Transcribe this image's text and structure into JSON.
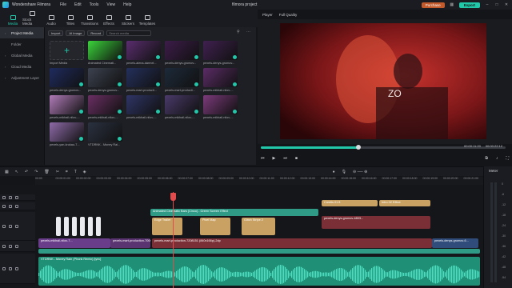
{
  "app": {
    "name": "Wondershare Filmora",
    "project_name": "filmora project"
  },
  "menu": [
    "File",
    "Edit",
    "Tools",
    "View",
    "Help"
  ],
  "header_buttons": {
    "purchase": "Purchase",
    "export": "Export"
  },
  "toolbar": [
    {
      "label": "Media",
      "active": true
    },
    {
      "label": "Stock Media",
      "active": false
    },
    {
      "label": "Audio",
      "active": false
    },
    {
      "label": "Titles",
      "active": false
    },
    {
      "label": "Transitions",
      "active": false
    },
    {
      "label": "Effects",
      "active": false
    },
    {
      "label": "Stickers",
      "active": false
    },
    {
      "label": "Templates",
      "active": false
    }
  ],
  "sidebar": [
    {
      "label": "Project Media",
      "active": true
    },
    {
      "label": "Folder",
      "active": false
    },
    {
      "label": "Global Media",
      "active": false
    },
    {
      "label": "Cloud Media",
      "active": false
    },
    {
      "label": "Adjustment Layer",
      "active": false
    }
  ],
  "media_tools": {
    "import": "Import",
    "ai_image": "AI Image",
    "record": "Record",
    "search_placeholder": "Search media"
  },
  "media_items": [
    {
      "label": "Import Media",
      "type": "import"
    },
    {
      "label": "Animated Cinemati...",
      "color": "#3ad43a"
    },
    {
      "label": "pexels-alena-darmel...",
      "color": "#5a2d6e"
    },
    {
      "label": "pexels-denys-gromov...",
      "color": "#3d1c4a"
    },
    {
      "label": "pexels-denys-gromov...",
      "color": "#402050"
    },
    {
      "label": "pexels-denys-gromov...",
      "color": "#1f2b5e"
    },
    {
      "label": "pexels-denys-gromov...",
      "color": "#3c4250"
    },
    {
      "label": "pexels-mart-producti...",
      "color": "#24305c"
    },
    {
      "label": "pexels-mart-producti...",
      "color": "#1d2a3a"
    },
    {
      "label": "pexels-mikhail-nilov-...",
      "color": "#5b2c66"
    },
    {
      "label": "pexels-mikhail-nilov-...",
      "color": "#b07bb8"
    },
    {
      "label": "pexels-mikhail-nilov-...",
      "color": "#6a2f63"
    },
    {
      "label": "pexels-mikhail-nilov-...",
      "color": "#2f3566"
    },
    {
      "label": "pexels-mikhail-nilov-...",
      "color": "#4a3a6a"
    },
    {
      "label": "pexels-mikhail-nilov-...",
      "color": "#7b3a7a"
    },
    {
      "label": "pexels-yan-krukau-7...",
      "color": "#8e6aa8"
    },
    {
      "label": "VTDRNK - Money Rai...",
      "color": "#2a3140"
    }
  ],
  "player": {
    "tab": "Player",
    "quality": "Full Quality",
    "current_time": "00:00:11:20",
    "total_time": "00:00:22:12",
    "progress": 0.4
  },
  "ruler_ticks": [
    "00:00",
    "00:00:01:00",
    "00:00:02:00",
    "00:00:03:00",
    "00:00:04:00",
    "00:00:05:00",
    "00:00:06:00",
    "00:00:07:00",
    "00:00:08:00",
    "00:00:09:00",
    "00:00:10:00",
    "00:00:11:00",
    "00:00:12:00",
    "00:00:13:00",
    "00:00:14:00",
    "00:00:15:00",
    "00:00:16:00",
    "00:00:17:00",
    "00:00:18:00",
    "00:00:19:00",
    "00:00:20:00",
    "00:00:21:00"
  ],
  "clips": {
    "title_top1": "Credits 01 ft",
    "title_top2": "Intro 02 Effect",
    "cinematic": "Animated Cinematic Bars (Cinco) - Green Screen Effect",
    "text1": "Edge Trailer",
    "text2": "Pixel Map",
    "text3": "Glitch Stripe 2",
    "video_r": "pexels-denys-gromov-4803...",
    "main1": "pexels-mikhail-nilov-7...",
    "main2": "pexels-mart-production-7006...",
    "main3": "pexels-mart-production-7208151 (840x166p)-2dp",
    "main4": "pexels-denys-gromov-6...",
    "audio": "VTDRNK - Money Rain (Phonk Remix) [lyric]"
  },
  "meter": {
    "title": "Meter",
    "labels": [
      "0",
      "-6",
      "-12",
      "-18",
      "-24",
      "-30",
      "-36",
      "-42",
      "-48",
      "-54"
    ]
  },
  "colors": {
    "accent": "#22c7a9",
    "purchase": "#c25a2b",
    "playhead": "#e24b4b",
    "title_clip": "#c9a162",
    "effect_clip": "#2f9a86",
    "video_clip": "#7a2f36",
    "audio_clip": "#1f8f76"
  }
}
